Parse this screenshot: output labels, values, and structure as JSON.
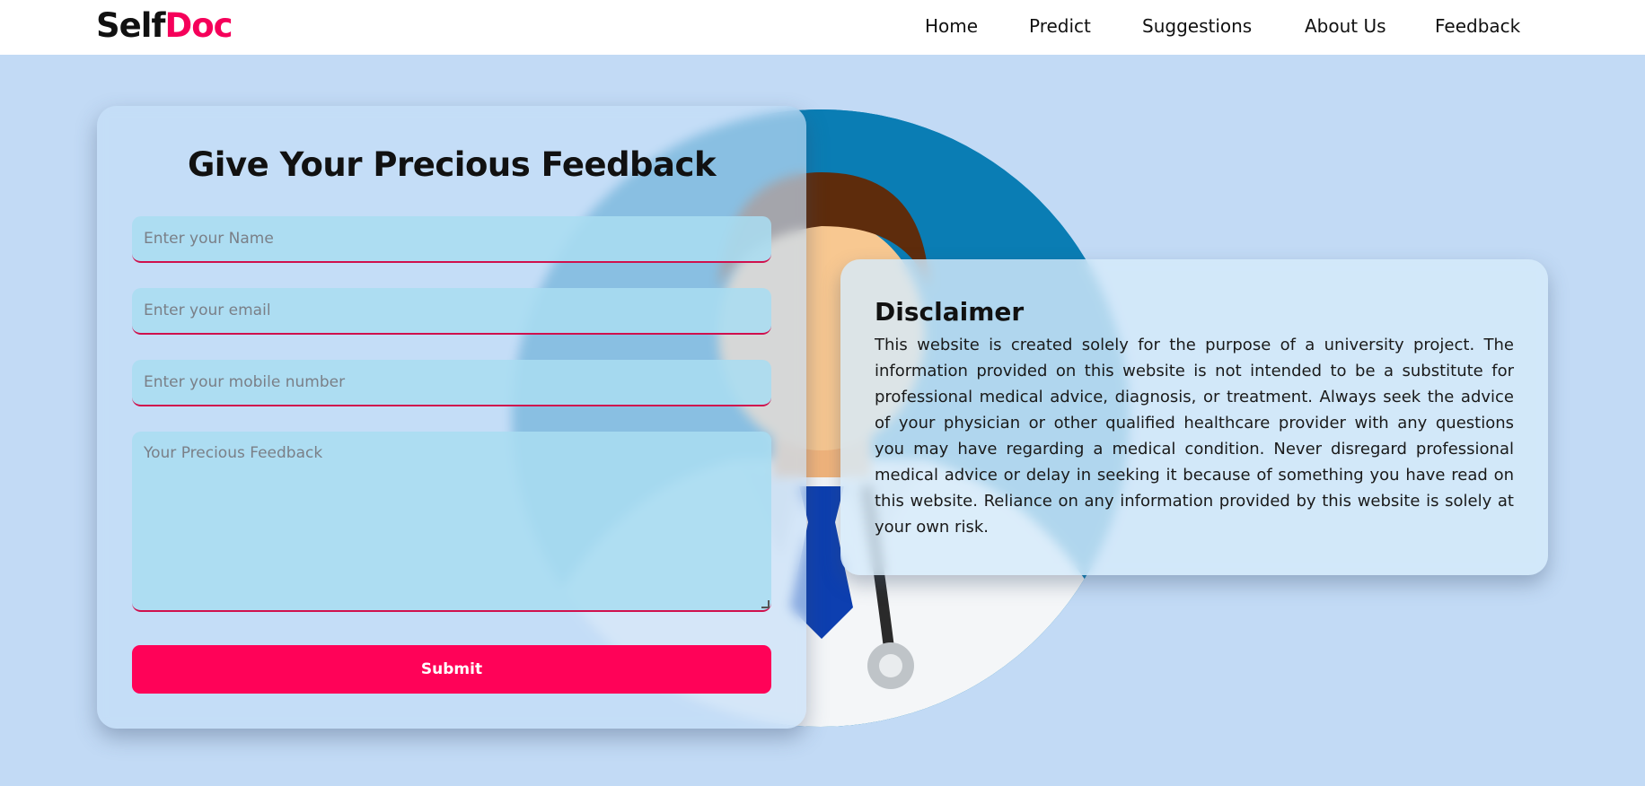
{
  "brand": {
    "part1": "Self",
    "part2": "Doc",
    "accent_color": "#f5005a"
  },
  "nav": [
    {
      "label": "Home"
    },
    {
      "label": "Predict"
    },
    {
      "label": "Suggestions"
    },
    {
      "label": "About Us"
    },
    {
      "label": "Feedback"
    }
  ],
  "form": {
    "title": "Give Your Precious Feedback",
    "name_placeholder": "Enter your Name",
    "email_placeholder": "Enter your email",
    "mobile_placeholder": "Enter your mobile number",
    "feedback_placeholder": "Your Precious Feedback",
    "submit_label": "Submit"
  },
  "disclaimer": {
    "title": "Disclaimer",
    "text": "This website is created solely for the purpose of a university project. The information provided on this website is not intended to be a substitute for professional medical advice, diagnosis, or treatment. Always seek the advice of your physician or other qualified healthcare provider with any questions you may have regarding a medical condition. Never disregard professional medical advice or delay in seeking it because of something you have read on this website. Reliance on any information provided by this website is solely at your own risk."
  },
  "colors": {
    "background": "#c2daf5",
    "button": "#ff0258",
    "field_border": "#d0104d"
  },
  "illustration": "doctor-illustration"
}
